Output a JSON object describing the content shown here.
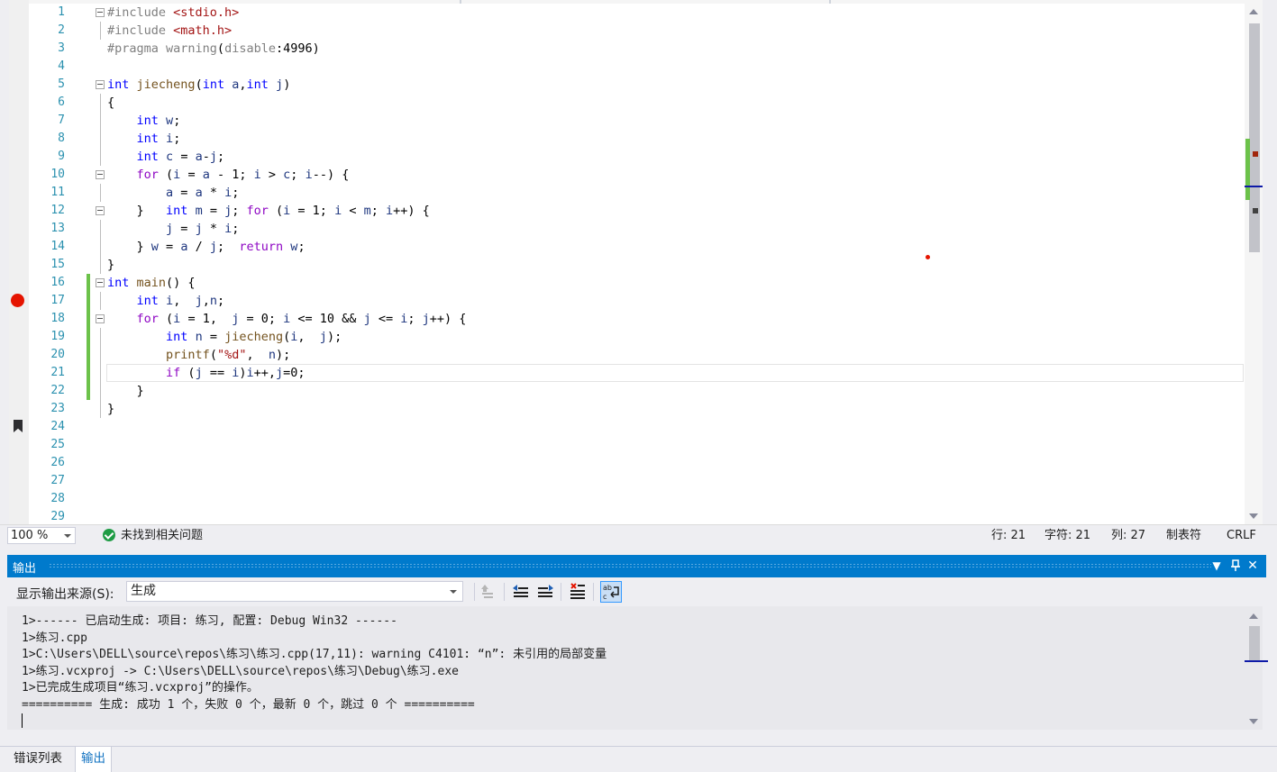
{
  "editor": {
    "line_numbers": [
      "1",
      "2",
      "3",
      "4",
      "5",
      "6",
      "7",
      "8",
      "9",
      "10",
      "11",
      "12",
      "13",
      "14",
      "15",
      "16",
      "17",
      "18",
      "19",
      "20",
      "21",
      "22",
      "23",
      "24",
      "25",
      "26",
      "27",
      "28",
      "29"
    ],
    "lines": [
      {
        "n": 1,
        "fold": true,
        "guide": false,
        "tokens": [
          [
            "pp",
            "#include "
          ],
          [
            "inc",
            "<stdio.h>"
          ]
        ]
      },
      {
        "n": 2,
        "fold": false,
        "guide": true,
        "tokens": [
          [
            "pp",
            "#include "
          ],
          [
            "inc",
            "<math.h>"
          ]
        ]
      },
      {
        "n": 3,
        "fold": false,
        "guide": false,
        "tokens": [
          [
            "pp",
            "#pragma warning"
          ],
          [
            "punc",
            "("
          ],
          [
            "pp",
            "disable"
          ],
          [
            "punc",
            ":4996)"
          ]
        ]
      },
      {
        "n": 4,
        "tokens": []
      },
      {
        "n": 5,
        "fold": true,
        "tokens": [
          [
            "kw",
            "int"
          ],
          [
            "punc",
            " "
          ],
          [
            "fn",
            "jiecheng"
          ],
          [
            "punc",
            "("
          ],
          [
            "kw",
            "int"
          ],
          [
            "punc",
            " "
          ],
          [
            "var",
            "a"
          ],
          [
            "punc",
            ","
          ],
          [
            "kw",
            "int"
          ],
          [
            "punc",
            " "
          ],
          [
            "var",
            "j"
          ],
          [
            "punc",
            ")"
          ]
        ]
      },
      {
        "n": 6,
        "guide": true,
        "tokens": [
          [
            "punc",
            "{"
          ]
        ]
      },
      {
        "n": 7,
        "guide": true,
        "tokens": [
          [
            "punc",
            "    "
          ],
          [
            "kw",
            "int"
          ],
          [
            "punc",
            " "
          ],
          [
            "var",
            "w"
          ],
          [
            "punc",
            ";"
          ]
        ]
      },
      {
        "n": 8,
        "guide": true,
        "tokens": [
          [
            "punc",
            "    "
          ],
          [
            "kw",
            "int"
          ],
          [
            "punc",
            " "
          ],
          [
            "var",
            "i"
          ],
          [
            "punc",
            ";"
          ]
        ]
      },
      {
        "n": 9,
        "guide": true,
        "tokens": [
          [
            "punc",
            "    "
          ],
          [
            "kw",
            "int"
          ],
          [
            "punc",
            " "
          ],
          [
            "var",
            "c"
          ],
          [
            "punc",
            " = "
          ],
          [
            "var",
            "a"
          ],
          [
            "punc",
            "-"
          ],
          [
            "var",
            "j"
          ],
          [
            "punc",
            ";"
          ]
        ]
      },
      {
        "n": 10,
        "fold": true,
        "tokens": [
          [
            "punc",
            "    "
          ],
          [
            "kw2",
            "for"
          ],
          [
            "punc",
            " ("
          ],
          [
            "var",
            "i"
          ],
          [
            "punc",
            " = "
          ],
          [
            "var",
            "a"
          ],
          [
            "punc",
            " - 1; "
          ],
          [
            "var",
            "i"
          ],
          [
            "punc",
            " > "
          ],
          [
            "var",
            "c"
          ],
          [
            "punc",
            "; "
          ],
          [
            "var",
            "i"
          ],
          [
            "punc",
            "--) {"
          ]
        ]
      },
      {
        "n": 11,
        "guide": true,
        "tokens": [
          [
            "punc",
            "        "
          ],
          [
            "var",
            "a"
          ],
          [
            "punc",
            " = "
          ],
          [
            "var",
            "a"
          ],
          [
            "punc",
            " * "
          ],
          [
            "var",
            "i"
          ],
          [
            "punc",
            ";"
          ]
        ]
      },
      {
        "n": 12,
        "fold": true,
        "tokens": [
          [
            "punc",
            "    }   "
          ],
          [
            "kw",
            "int"
          ],
          [
            "punc",
            " "
          ],
          [
            "var",
            "m"
          ],
          [
            "punc",
            " = "
          ],
          [
            "var",
            "j"
          ],
          [
            "punc",
            "; "
          ],
          [
            "kw2",
            "for"
          ],
          [
            "punc",
            " ("
          ],
          [
            "var",
            "i"
          ],
          [
            "punc",
            " = 1; "
          ],
          [
            "var",
            "i"
          ],
          [
            "punc",
            " < "
          ],
          [
            "var",
            "m"
          ],
          [
            "punc",
            "; "
          ],
          [
            "var",
            "i"
          ],
          [
            "punc",
            "++) {"
          ]
        ]
      },
      {
        "n": 13,
        "guide": true,
        "tokens": [
          [
            "punc",
            "        "
          ],
          [
            "var",
            "j"
          ],
          [
            "punc",
            " = "
          ],
          [
            "var",
            "j"
          ],
          [
            "punc",
            " * "
          ],
          [
            "var",
            "i"
          ],
          [
            "punc",
            ";"
          ]
        ]
      },
      {
        "n": 14,
        "guide": true,
        "tokens": [
          [
            "punc",
            "    } "
          ],
          [
            "var",
            "w"
          ],
          [
            "punc",
            " = "
          ],
          [
            "var",
            "a"
          ],
          [
            "punc",
            " / "
          ],
          [
            "var",
            "j"
          ],
          [
            "punc",
            ";  "
          ],
          [
            "kw2",
            "return"
          ],
          [
            "punc",
            " "
          ],
          [
            "var",
            "w"
          ],
          [
            "punc",
            ";"
          ]
        ]
      },
      {
        "n": 15,
        "guide": true,
        "tokens": [
          [
            "punc",
            "}"
          ]
        ]
      },
      {
        "n": 16,
        "fold": true,
        "tokens": [
          [
            "kw",
            "int"
          ],
          [
            "punc",
            " "
          ],
          [
            "fn",
            "main"
          ],
          [
            "punc",
            "() {"
          ]
        ]
      },
      {
        "n": 17,
        "guide": true,
        "tokens": [
          [
            "punc",
            "    "
          ],
          [
            "kw",
            "int"
          ],
          [
            "punc",
            " "
          ],
          [
            "var",
            "i"
          ],
          [
            "punc",
            ",  "
          ],
          [
            "var",
            "j"
          ],
          [
            "punc",
            ","
          ],
          [
            "var",
            "n"
          ],
          [
            "punc",
            ";"
          ]
        ]
      },
      {
        "n": 18,
        "fold": true,
        "tokens": [
          [
            "punc",
            "    "
          ],
          [
            "kw2",
            "for"
          ],
          [
            "punc",
            " ("
          ],
          [
            "var",
            "i"
          ],
          [
            "punc",
            " = 1,  "
          ],
          [
            "var",
            "j"
          ],
          [
            "punc",
            " = 0; "
          ],
          [
            "var",
            "i"
          ],
          [
            "punc",
            " <= 10 && "
          ],
          [
            "var",
            "j"
          ],
          [
            "punc",
            " <= "
          ],
          [
            "var",
            "i"
          ],
          [
            "punc",
            "; "
          ],
          [
            "var",
            "j"
          ],
          [
            "punc",
            "++) {"
          ]
        ]
      },
      {
        "n": 19,
        "guide": true,
        "tokens": [
          [
            "punc",
            "        "
          ],
          [
            "kw",
            "int"
          ],
          [
            "punc",
            " "
          ],
          [
            "var",
            "n"
          ],
          [
            "punc",
            " = "
          ],
          [
            "fn",
            "jiecheng"
          ],
          [
            "punc",
            "("
          ],
          [
            "var",
            "i"
          ],
          [
            "punc",
            ",  "
          ],
          [
            "var",
            "j"
          ],
          [
            "punc",
            ");"
          ]
        ]
      },
      {
        "n": 20,
        "guide": true,
        "tokens": [
          [
            "punc",
            "        "
          ],
          [
            "fn",
            "printf"
          ],
          [
            "punc",
            "("
          ],
          [
            "str",
            "\"%d\""
          ],
          [
            "punc",
            ",  "
          ],
          [
            "var",
            "n"
          ],
          [
            "punc",
            ");"
          ]
        ]
      },
      {
        "n": 21,
        "guide": true,
        "current": true,
        "tokens": [
          [
            "punc",
            "        "
          ],
          [
            "kw2",
            "if"
          ],
          [
            "punc",
            " ("
          ],
          [
            "var",
            "j"
          ],
          [
            "punc",
            " == "
          ],
          [
            "var",
            "i"
          ],
          [
            "punc",
            ")"
          ],
          [
            "var",
            "i"
          ],
          [
            "punc",
            "++,"
          ],
          [
            "var",
            "j"
          ],
          [
            "punc",
            "=0;"
          ]
        ]
      },
      {
        "n": 22,
        "guide": true,
        "tokens": [
          [
            "punc",
            "    }"
          ]
        ]
      },
      {
        "n": 23,
        "guide": true,
        "tokens": [
          [
            "punc",
            "}"
          ]
        ]
      },
      {
        "n": 24,
        "tokens": []
      },
      {
        "n": 25,
        "tokens": []
      },
      {
        "n": 26,
        "tokens": []
      },
      {
        "n": 27,
        "tokens": []
      },
      {
        "n": 28,
        "tokens": []
      },
      {
        "n": 29,
        "tokens": []
      }
    ]
  },
  "status_bar": {
    "zoom": "100 %",
    "issues": "未找到相关问题",
    "line": "行: 21",
    "char": "字符: 21",
    "col": "列: 27",
    "indent": "制表符",
    "eol": "CRLF"
  },
  "output": {
    "title": "输出",
    "source_label": "显示输出来源(S):",
    "source_value": "生成",
    "lines": [
      "1>------ 已启动生成: 项目: 练习, 配置: Debug Win32 ------",
      "1>练习.cpp",
      "1>C:\\Users\\DELL\\source\\repos\\练习\\练习.cpp(17,11): warning C4101: “n”: 未引用的局部变量",
      "1>练习.vcxproj -> C:\\Users\\DELL\\source\\repos\\练习\\Debug\\练习.exe",
      "1>已完成生成项目“练习.vcxproj”的操作。",
      "========== 生成: 成功 1 个，失败 0 个，最新 0 个，跳过 0 个 =========="
    ],
    "title_buttons": [
      "▼",
      "ᴨ",
      "✕"
    ]
  },
  "bottom_tabs": [
    "错误列表",
    "输出"
  ],
  "colors": {
    "accent": "#007acc",
    "keyword": "#0000ff",
    "control_keyword": "#8f08c4",
    "breakpoint": "#e51400",
    "change_marker": "#6cc24a"
  }
}
